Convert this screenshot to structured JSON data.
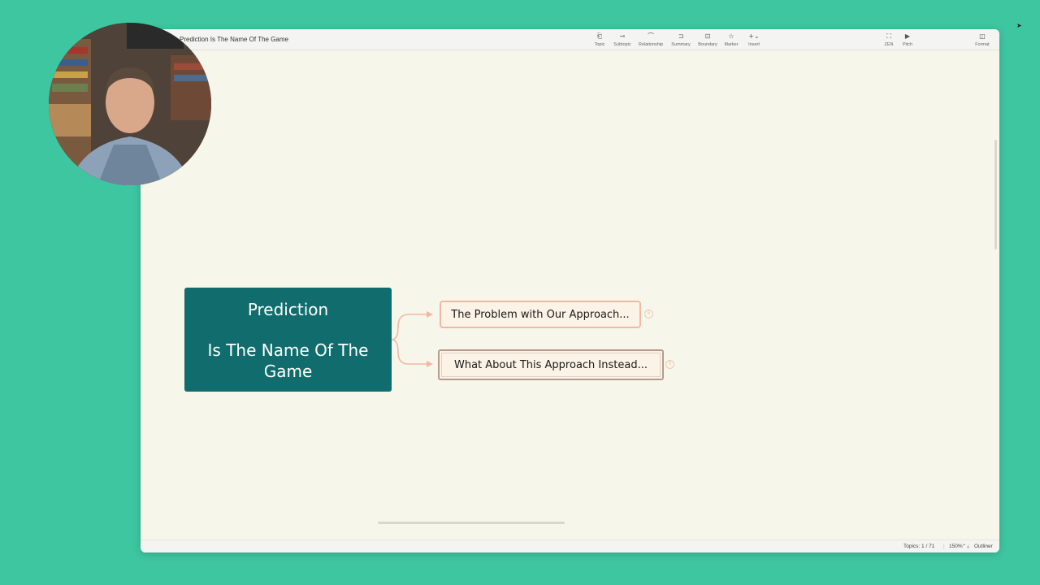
{
  "window": {
    "title": "Prediction Is The Name Of The Game"
  },
  "toolbar": [
    {
      "id": "topic",
      "label": "Topic",
      "icon": "topic-icon",
      "glyph": "⎗"
    },
    {
      "id": "subtopic",
      "label": "Subtopic",
      "icon": "subtopic-icon",
      "glyph": "⊸"
    },
    {
      "id": "relationship",
      "label": "Relationship",
      "icon": "relationship-icon",
      "glyph": "⌒"
    },
    {
      "id": "summary",
      "label": "Summary",
      "icon": "summary-icon",
      "glyph": "⊐"
    },
    {
      "id": "boundary",
      "label": "Boundary",
      "icon": "boundary-icon",
      "glyph": "⊡"
    },
    {
      "id": "marker",
      "label": "Marker",
      "icon": "marker-icon",
      "glyph": "☆"
    },
    {
      "id": "insert",
      "label": "Insert",
      "icon": "insert-icon",
      "glyph": "+⌄"
    },
    {
      "id": "zen",
      "label": "ZEN",
      "icon": "zen-icon",
      "glyph": "⛶"
    },
    {
      "id": "pitch",
      "label": "Pitch",
      "icon": "pitch-icon",
      "glyph": "▶"
    },
    {
      "id": "format",
      "label": "Format",
      "icon": "format-icon",
      "glyph": "◫"
    }
  ],
  "mindmap": {
    "central_topic": {
      "line1": "Prediction",
      "line2": "Is The Name Of The Game",
      "color": "#116d6d"
    },
    "subtopics": [
      {
        "label": "The Problem with Our Approach...",
        "badge": "5",
        "border": "#f1b9a3"
      },
      {
        "label": "What About This Approach Instead...",
        "badge": "5",
        "border": "#b79a8e"
      }
    ],
    "connector_color": "#f1b9a3"
  },
  "status": {
    "topics": "Topics: 1 / 71",
    "zoom": "150%",
    "zoom_stepper": "⌃⌄",
    "outliner": "Outliner"
  },
  "colors": {
    "background": "#3ec6a1",
    "canvas": "#f7f6ea"
  }
}
